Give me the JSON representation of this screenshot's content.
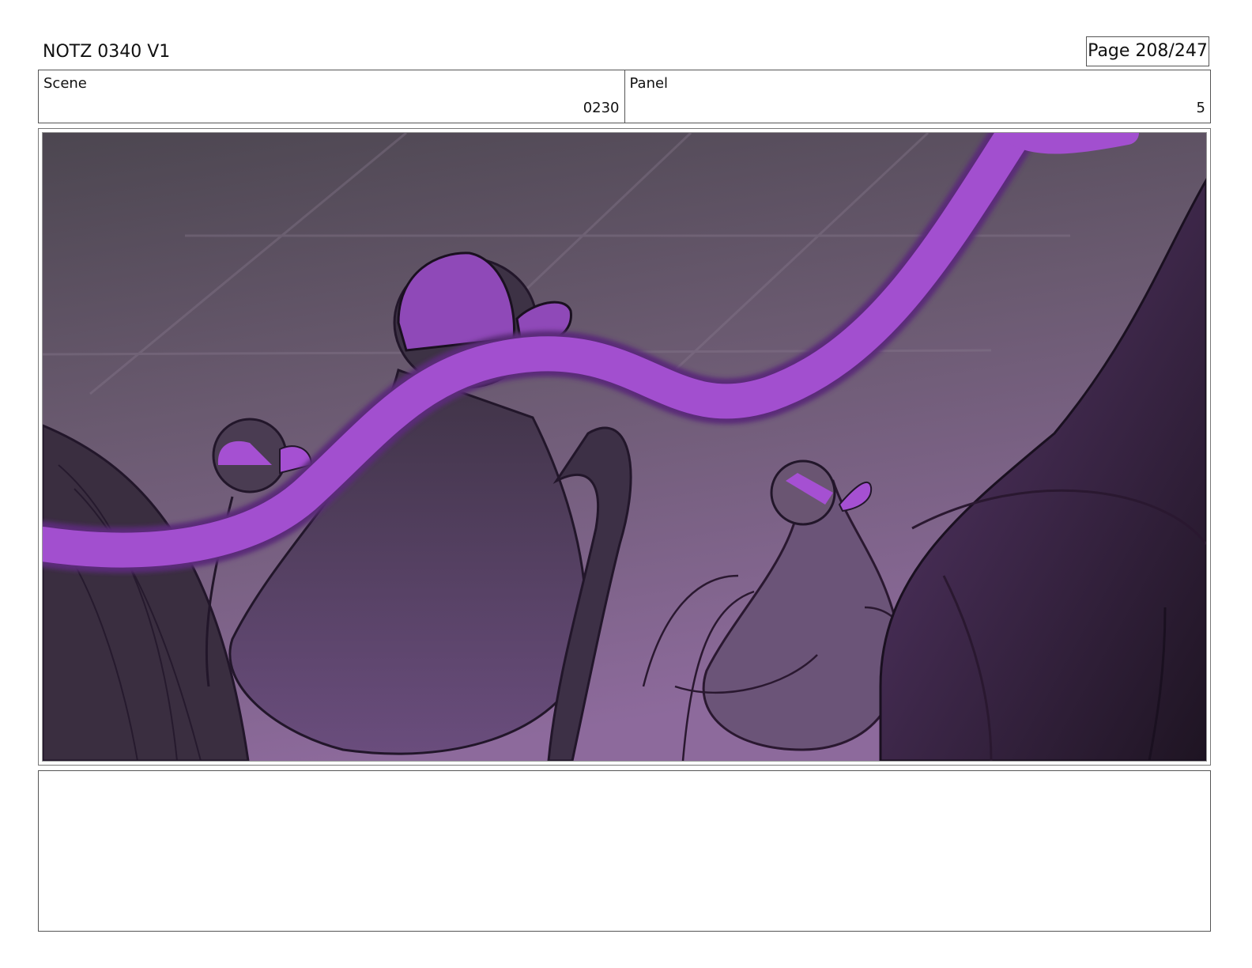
{
  "header": {
    "title": "NOTZ 0340 V1",
    "page_label": "Page 208/247"
  },
  "scene": {
    "label": "Scene",
    "value": "0230"
  },
  "panel": {
    "label": "Panel",
    "value": "5"
  },
  "artwork": {
    "description_icon": "storyboard-sketch",
    "colors": {
      "bg_top": "#524a55",
      "bg_bottom": "#8a6a98",
      "tendril": "#a24fcf",
      "line": "#2a1830",
      "body": "#4a3556"
    }
  },
  "notes": {
    "text": ""
  }
}
